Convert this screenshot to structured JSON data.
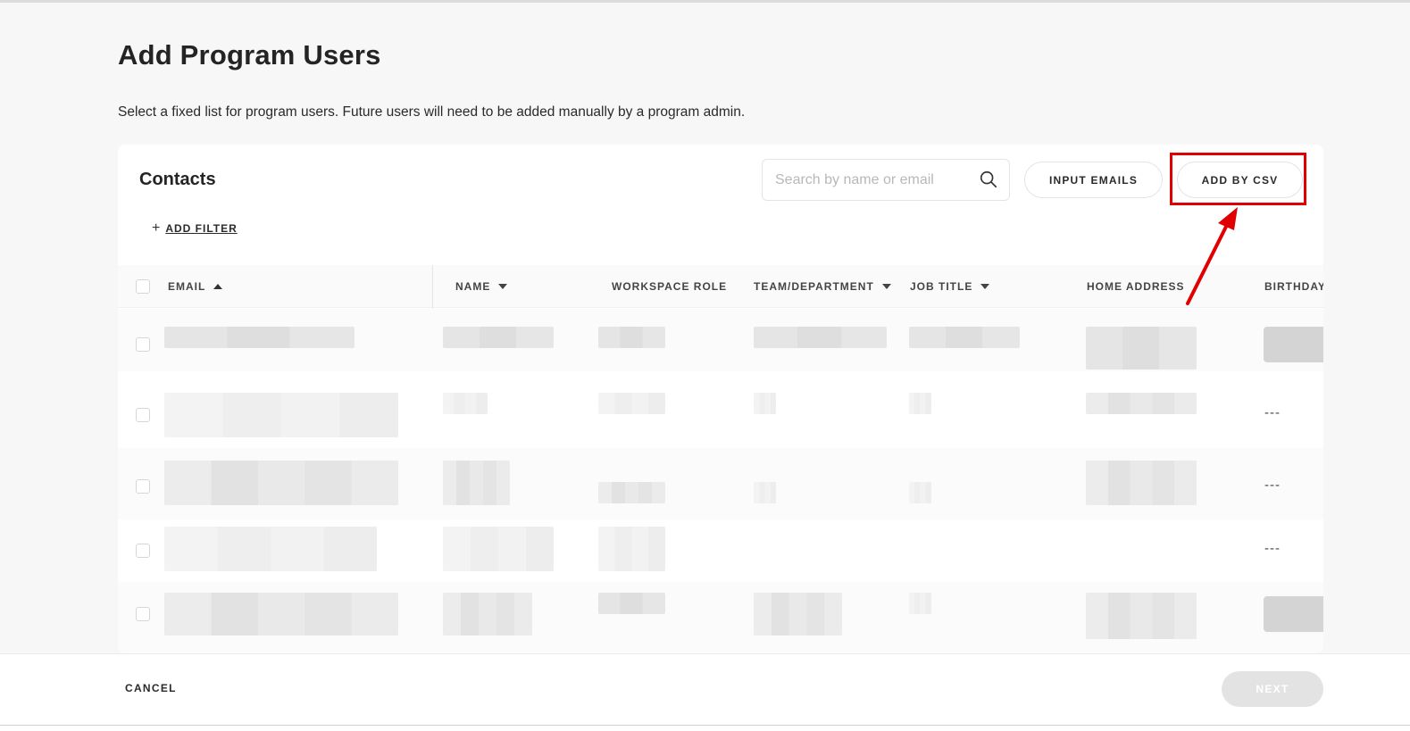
{
  "page": {
    "title": "Add Program Users",
    "subtitle": "Select a fixed list for program users. Future users will need to be added manually by a program admin."
  },
  "contacts": {
    "title": "Contacts",
    "search": {
      "placeholder": "Search by name or email",
      "value": "",
      "icon": "search-icon"
    },
    "input_emails_label": "INPUT EMAILS",
    "add_by_csv_label": "ADD BY CSV",
    "add_filter": {
      "icon": "plus",
      "label": "ADD FILTER"
    }
  },
  "table": {
    "columns": [
      {
        "key": "email",
        "label": "EMAIL",
        "sort": "ascending"
      },
      {
        "key": "name",
        "label": "NAME",
        "sort": "dropdown"
      },
      {
        "key": "workspace_role",
        "label": "WORKSPACE ROLE",
        "sort": "none"
      },
      {
        "key": "team",
        "label": "TEAM/DEPARTMENT",
        "sort": "dropdown"
      },
      {
        "key": "job_title",
        "label": "JOB TITLE",
        "sort": "dropdown"
      },
      {
        "key": "home_address",
        "label": "HOME ADDRESS",
        "sort": "none"
      },
      {
        "key": "birthday",
        "label": "BIRTHDAY",
        "sort": "none"
      }
    ],
    "rows": [
      {
        "birthday": ""
      },
      {
        "birthday": "---"
      },
      {
        "birthday": "---"
      },
      {
        "birthday": "---"
      },
      {
        "birthday": ""
      }
    ]
  },
  "footer": {
    "cancel_label": "CANCEL",
    "next_label": "NEXT"
  },
  "colors": {
    "accent_highlight": "#e00000",
    "next_disabled": "#e3e3e3",
    "background": "#f7f7f7"
  }
}
